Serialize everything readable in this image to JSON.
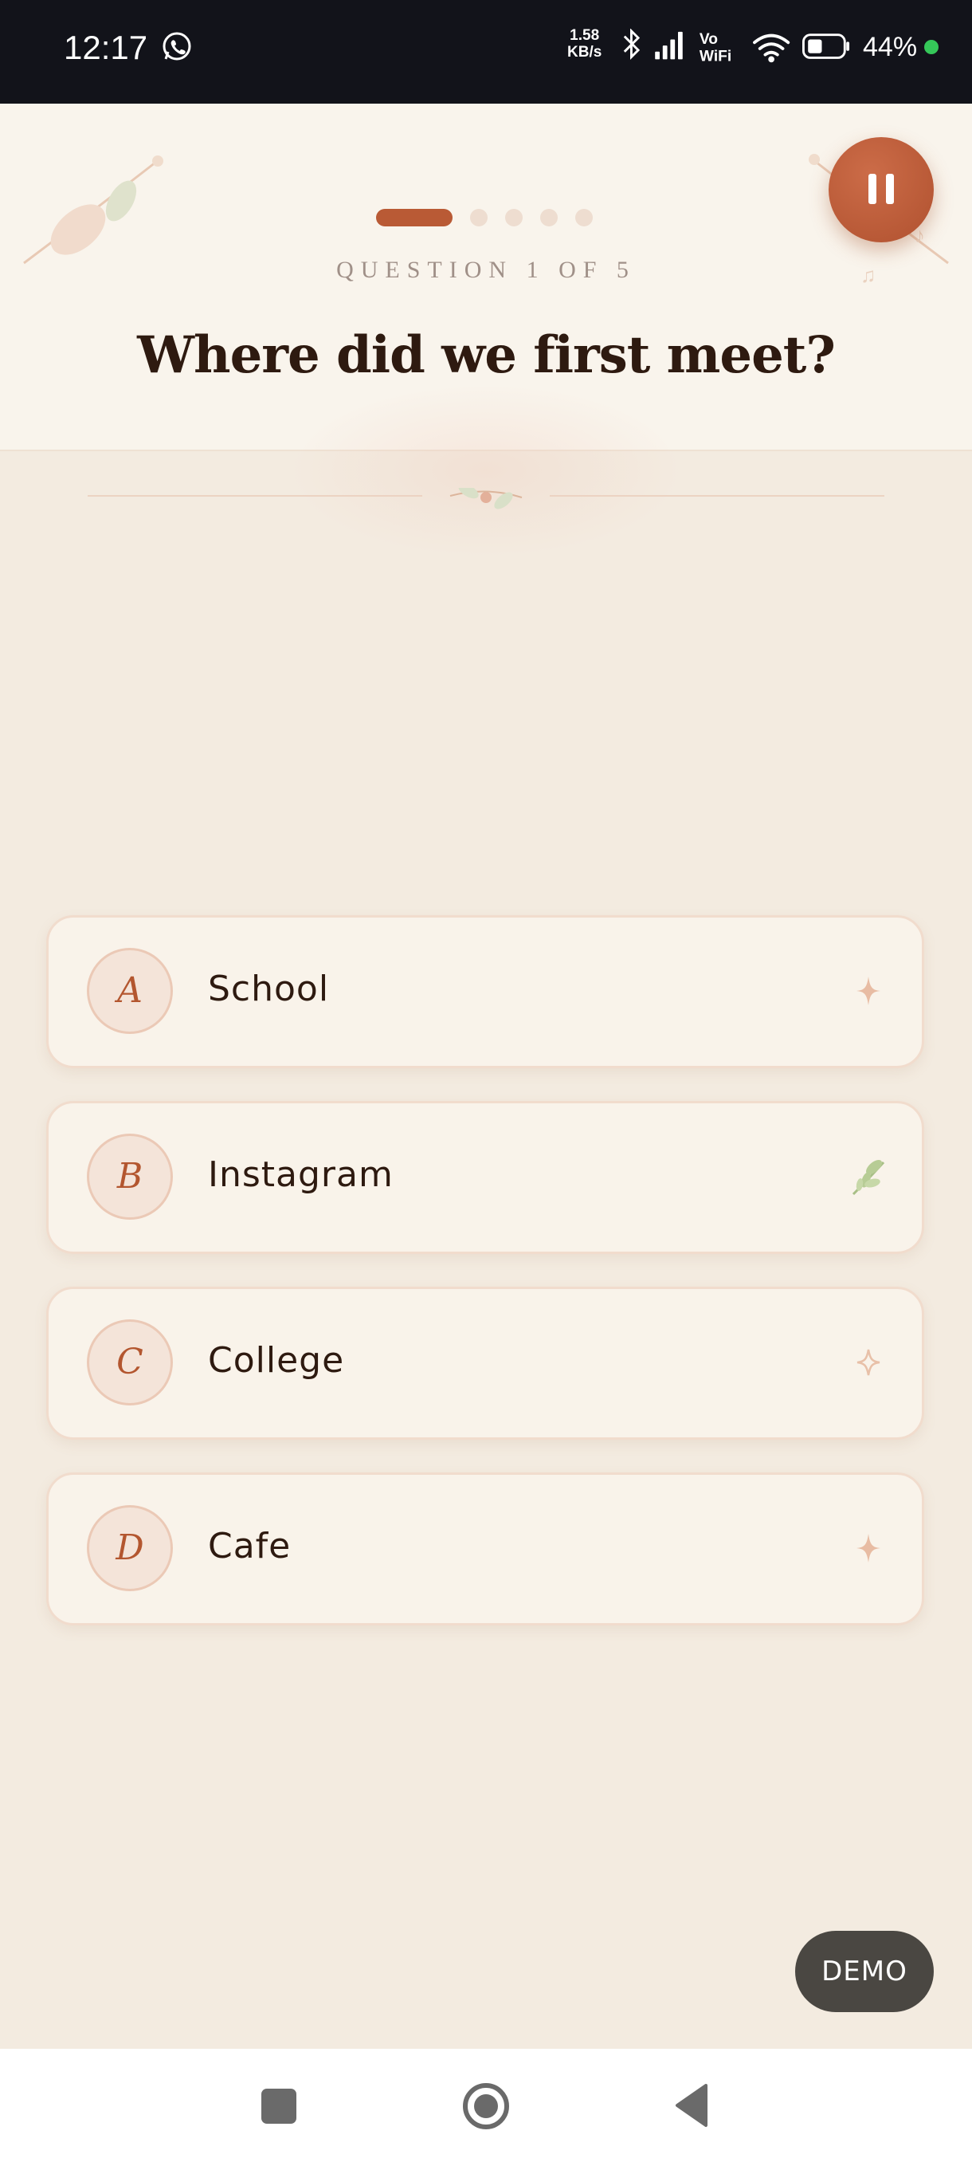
{
  "status_bar": {
    "time": "12:17",
    "speed_value": "1.58",
    "speed_unit": "KB/s",
    "vowifi_top": "Vo",
    "vowifi_bottom": "WiFi",
    "battery": "44%",
    "icons": [
      "whatsapp-icon",
      "bluetooth-icon",
      "signal-icon",
      "vowifi-icon",
      "wifi-icon",
      "battery-icon"
    ]
  },
  "quiz": {
    "progress": {
      "current": 1,
      "total": 5
    },
    "question_label": "QUESTION 1 OF 5",
    "question": "Where did we first meet?",
    "options": [
      {
        "letter": "A",
        "text": "School",
        "icon": "sparkle-icon"
      },
      {
        "letter": "B",
        "text": "Instagram",
        "icon": "herb-icon"
      },
      {
        "letter": "C",
        "text": "College",
        "icon": "sparkle-outline-icon"
      },
      {
        "letter": "D",
        "text": "Cafe",
        "icon": "sparkle-icon"
      }
    ]
  },
  "demo_button": {
    "label": "DEMO"
  },
  "colors": {
    "accent": "#b95a35",
    "header_bg": "#f9f4ec",
    "text": "#2e1a10",
    "card_bg": "#f9f3ea"
  }
}
